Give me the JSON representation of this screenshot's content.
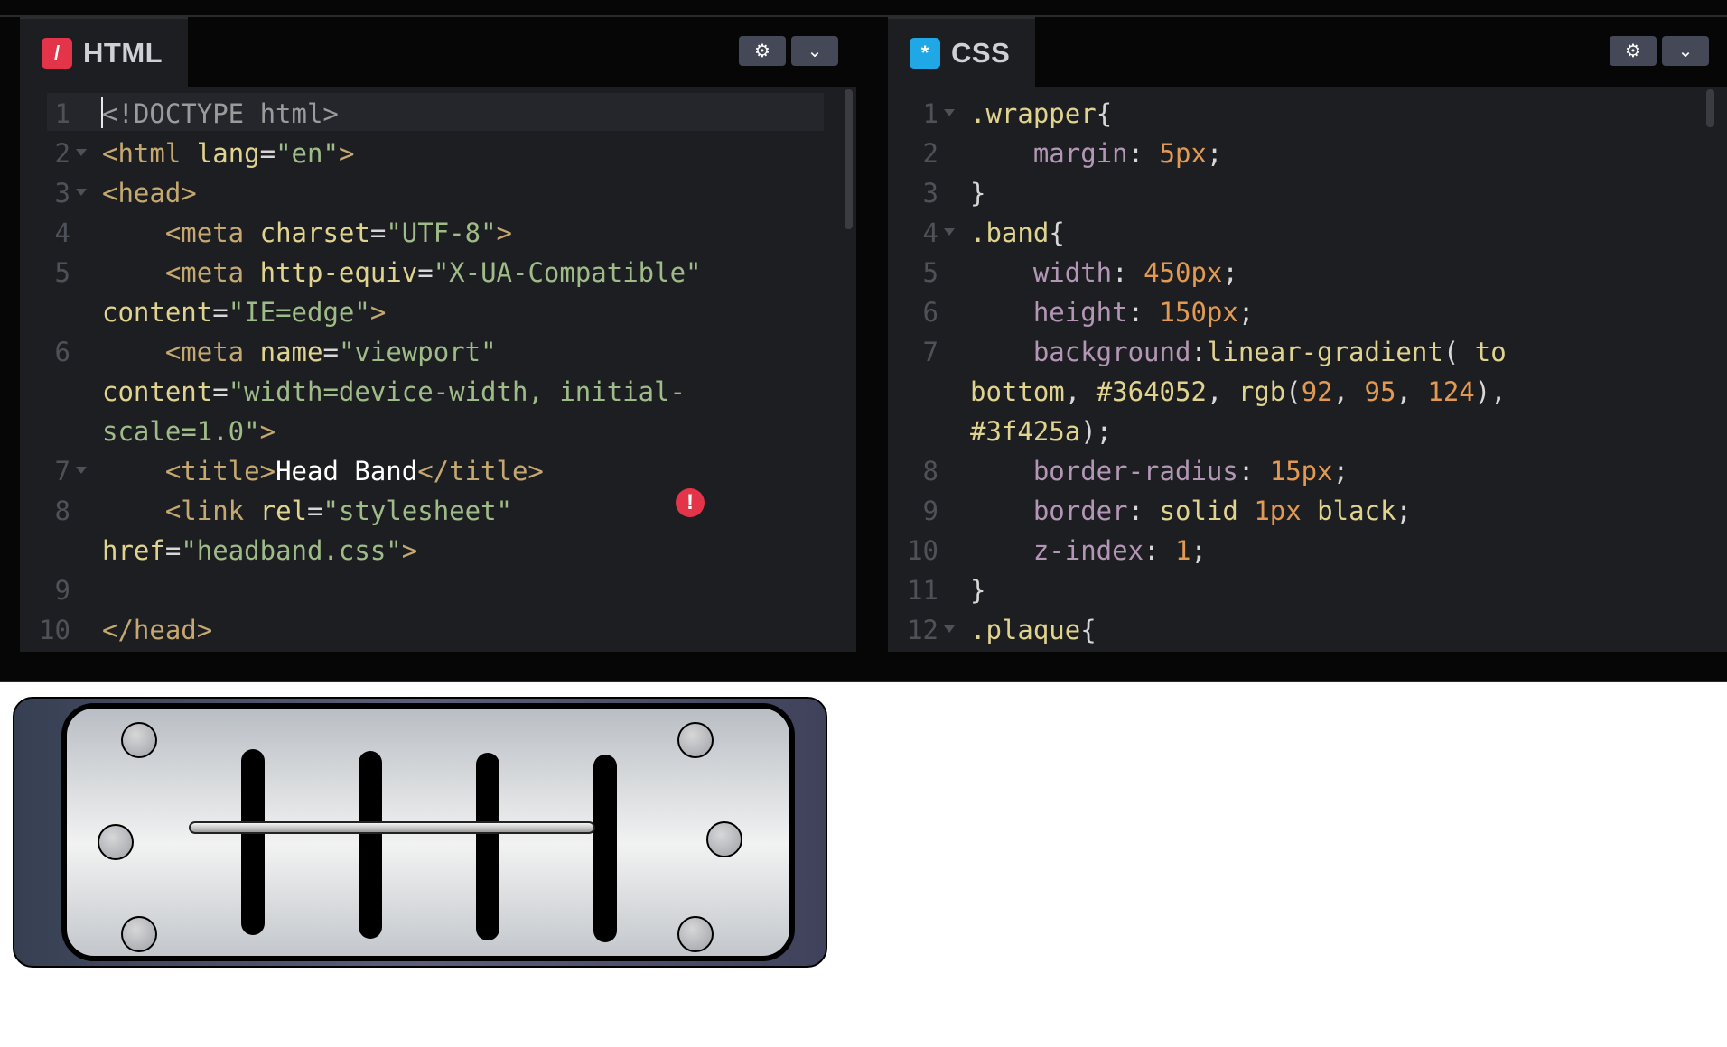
{
  "html_panel": {
    "tab_label": "HTML",
    "tab_icon": "html-slash-icon",
    "icon_color": "#e3344a",
    "lines": [
      {
        "n": "1",
        "html": "<span class=\"c-dtag\">&lt;!DOCTYPE html&gt;</span>"
      },
      {
        "n": "2",
        "html": "<span class=\"c-tag\">&lt;html</span> <span class=\"c-attr\">lang</span><span class=\"c-punc\">=</span><span class=\"c-str\">\"en\"</span><span class=\"c-tag\">&gt;</span>"
      },
      {
        "n": "3",
        "html": "<span class=\"c-tag\">&lt;head&gt;</span>"
      },
      {
        "n": "4",
        "html": "    <span class=\"c-tag\">&lt;meta</span> <span class=\"c-attr\">charset</span><span class=\"c-punc\">=</span><span class=\"c-str\">\"UTF-8\"</span><span class=\"c-tag\">&gt;</span>"
      },
      {
        "n": "5",
        "html": "    <span class=\"c-tag\">&lt;meta</span> <span class=\"c-attr\">http-equiv</span><span class=\"c-punc\">=</span><span class=\"c-str\">\"X-UA-Compatible\"</span>"
      },
      {
        "n": "",
        "html": "<span class=\"c-attr\">content</span><span class=\"c-punc\">=</span><span class=\"c-str\">\"IE=edge\"</span><span class=\"c-tag\">&gt;</span>"
      },
      {
        "n": "6",
        "html": "    <span class=\"c-tag\">&lt;meta</span> <span class=\"c-attr\">name</span><span class=\"c-punc\">=</span><span class=\"c-str\">\"viewport\"</span>"
      },
      {
        "n": "",
        "html": "<span class=\"c-attr\">content</span><span class=\"c-punc\">=</span><span class=\"c-str\">\"width=device-width, initial-</span>"
      },
      {
        "n": "",
        "html": "<span class=\"c-str\">scale=1.0\"</span><span class=\"c-tag\">&gt;</span>"
      },
      {
        "n": "7",
        "html": "    <span class=\"c-tag\">&lt;title&gt;</span><span class=\"c-txt\">Head Band</span><span class=\"c-tag\">&lt;/title&gt;</span>"
      },
      {
        "n": "8",
        "html": "    <span class=\"c-tag\">&lt;link</span> <span class=\"c-attr\">rel</span><span class=\"c-punc\">=</span><span class=\"c-str\">\"stylesheet\"</span>"
      },
      {
        "n": "",
        "html": "<span class=\"c-attr\">href</span><span class=\"c-punc\">=</span><span class=\"c-str\">\"headband.css\"</span><span class=\"c-tag\">&gt;</span>"
      },
      {
        "n": "9",
        "html": ""
      },
      {
        "n": "10",
        "html": "<span class=\"c-tag\">&lt;/head&gt;</span>"
      }
    ],
    "fold_lines": [
      "2",
      "3",
      "7"
    ],
    "error_badge": "!"
  },
  "css_panel": {
    "tab_label": "CSS",
    "tab_icon": "css-asterisk-icon",
    "icon_color": "#1fa7e6",
    "lines": [
      {
        "n": "1",
        "html": "<span class=\"c-sel\">.wrapper</span><span class=\"c-punc\">{</span>"
      },
      {
        "n": "2",
        "html": "    <span class=\"c-prop\">margin</span><span class=\"c-punc\">: </span><span class=\"c-num\">5px</span><span class=\"c-punc\">;</span>"
      },
      {
        "n": "3",
        "html": "<span class=\"c-punc\">}</span>"
      },
      {
        "n": "4",
        "html": "<span class=\"c-sel\">.band</span><span class=\"c-punc\">{</span>"
      },
      {
        "n": "5",
        "html": "    <span class=\"c-prop\">width</span><span class=\"c-punc\">: </span><span class=\"c-num\">450px</span><span class=\"c-punc\">;</span>"
      },
      {
        "n": "6",
        "html": "    <span class=\"c-prop\">height</span><span class=\"c-punc\">: </span><span class=\"c-num\">150px</span><span class=\"c-punc\">;</span>"
      },
      {
        "n": "7",
        "html": "    <span class=\"c-prop\">background</span><span class=\"c-punc\">:</span><span class=\"c-fn\">linear-gradient</span><span class=\"c-punc\">( </span><span class=\"c-val\">to</span>"
      },
      {
        "n": "",
        "html": "<span class=\"c-val\">bottom</span><span class=\"c-punc\">, </span><span class=\"c-val\">#364052</span><span class=\"c-punc\">, </span><span class=\"c-fn\">rgb</span><span class=\"c-punc\">(</span><span class=\"c-num\">92</span><span class=\"c-punc\">, </span><span class=\"c-num\">95</span><span class=\"c-punc\">, </span><span class=\"c-num\">124</span><span class=\"c-punc\">),</span>"
      },
      {
        "n": "",
        "html": "<span class=\"c-val\">#3f425a</span><span class=\"c-punc\">);</span>"
      },
      {
        "n": "8",
        "html": "    <span class=\"c-prop\">border-radius</span><span class=\"c-punc\">: </span><span class=\"c-num\">15px</span><span class=\"c-punc\">;</span>"
      },
      {
        "n": "9",
        "html": "    <span class=\"c-prop\">border</span><span class=\"c-punc\">: </span><span class=\"c-val\">solid</span> <span class=\"c-num\">1px</span> <span class=\"c-val\">black</span><span class=\"c-punc\">;</span>"
      },
      {
        "n": "10",
        "html": "    <span class=\"c-prop\">z-index</span><span class=\"c-punc\">: </span><span class=\"c-num\">1</span><span class=\"c-punc\">;</span>"
      },
      {
        "n": "11",
        "html": "<span class=\"c-punc\">}</span>"
      },
      {
        "n": "12",
        "html": "<span class=\"c-sel\">.plaque</span><span class=\"c-punc\">{</span>"
      }
    ],
    "fold_lines": [
      "1",
      "4",
      "12"
    ]
  },
  "buttons": {
    "settings_icon": "gear-icon",
    "collapse_icon": "chevron-down-icon"
  },
  "preview": {
    "band_colors": [
      "#364052",
      "#5c5f7c",
      "#3f425a"
    ]
  }
}
